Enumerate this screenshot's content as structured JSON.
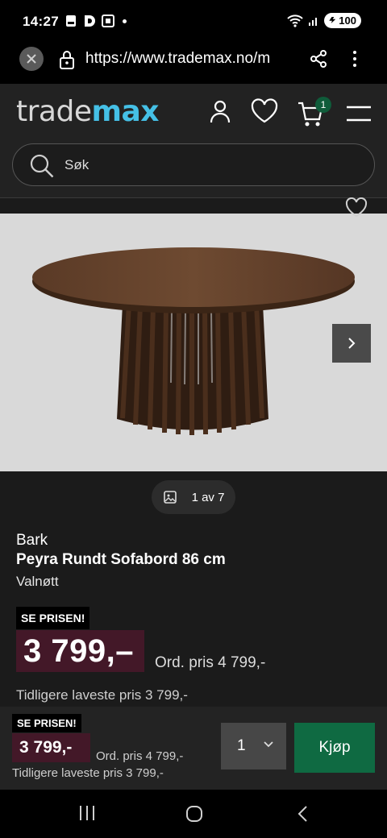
{
  "status_bar": {
    "time": "14:27",
    "battery": "100"
  },
  "browser": {
    "url": "https://www.trademax.no/m",
    "icons": [
      "close-icon",
      "lock-icon",
      "share-icon",
      "more-vert-icon"
    ]
  },
  "header": {
    "logo_part1": "trade",
    "logo_part2": "max",
    "cart_count": "1",
    "search_placeholder": "Søk",
    "icons": [
      "account-icon",
      "wishlist-icon",
      "cart-icon",
      "menu-icon"
    ]
  },
  "gallery": {
    "counter": "1 av 7"
  },
  "product": {
    "brand": "Bark",
    "name": "Peyra Rundt Sofabord 86 cm",
    "color": "Valnøtt",
    "price_tag": "SE PRISEN!",
    "price": "3 799,–",
    "ordinary_price": "Ord. pris 4 799,-",
    "previous_lowest": "Tidligere laveste pris 3 799,-"
  },
  "sticky_bar": {
    "price_tag": "SE PRISEN!",
    "price": "3 799,-",
    "ordinary_price": "Ord. pris 4 799,-",
    "previous_lowest": "Tidligere laveste pris 3 799,-",
    "quantity": "1",
    "buy_label": "Kjøp"
  },
  "colors": {
    "accent_green": "#0f6a42",
    "price_bg": "#431828",
    "logo_blue": "#45c0e6"
  }
}
